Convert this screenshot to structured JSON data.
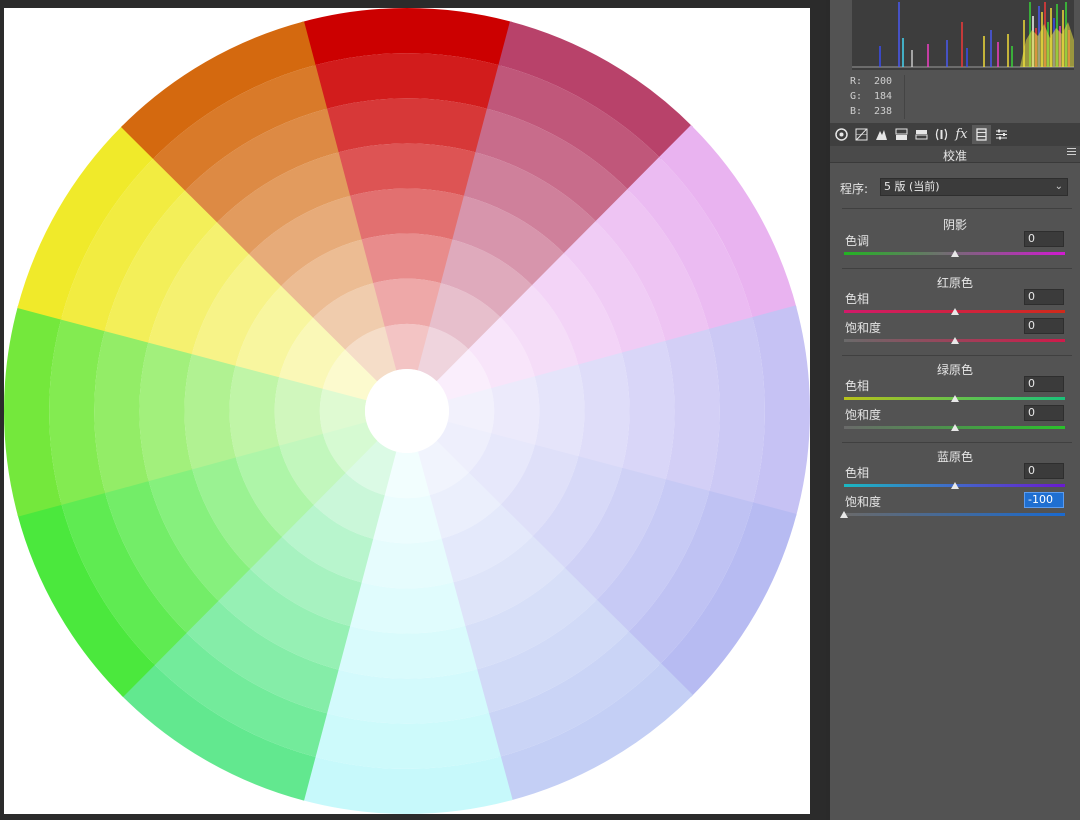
{
  "readout": {
    "r_label": "R:",
    "r_value": "200",
    "g_label": "G:",
    "g_value": "184",
    "b_label": "B:",
    "b_value": "238"
  },
  "toolbar": {
    "icons": [
      "aperture-icon",
      "tone-curve-icon",
      "detail-icon",
      "hsl-icon",
      "split-toning-icon",
      "lens-correction-icon",
      "effects-icon",
      "camera-calibration-icon",
      "presets-icon"
    ],
    "fx_glyph": "fx"
  },
  "panel": {
    "title": "校准",
    "process_label": "程序:",
    "process_value": "5 版 (当前)",
    "shadows": {
      "title": "阴影",
      "tint_label": "色调",
      "tint_value": "0",
      "tint": 0
    },
    "red_primary": {
      "title": "红原色",
      "hue_label": "色相",
      "hue_value": "0",
      "hue": 0,
      "sat_label": "饱和度",
      "sat_value": "0",
      "sat": 0
    },
    "green_primary": {
      "title": "绿原色",
      "hue_label": "色相",
      "hue_value": "0",
      "hue": 0,
      "sat_label": "饱和度",
      "sat_value": "0",
      "sat": 0
    },
    "blue_primary": {
      "title": "蓝原色",
      "hue_label": "色相",
      "hue_value": "0",
      "hue": 0,
      "sat_label": "饱和度",
      "sat_value": "-100",
      "sat": -100
    }
  },
  "wheel": {
    "segment_colors": [
      "#cc0000",
      "#b8426a",
      "#e9b3f0",
      "#c6c2f4",
      "#b7bbf2",
      "#c4cff5",
      "#c7f9fb",
      "#62e88f",
      "#4be83d",
      "#74e83c",
      "#f0ea2a",
      "#d4690f"
    ]
  }
}
